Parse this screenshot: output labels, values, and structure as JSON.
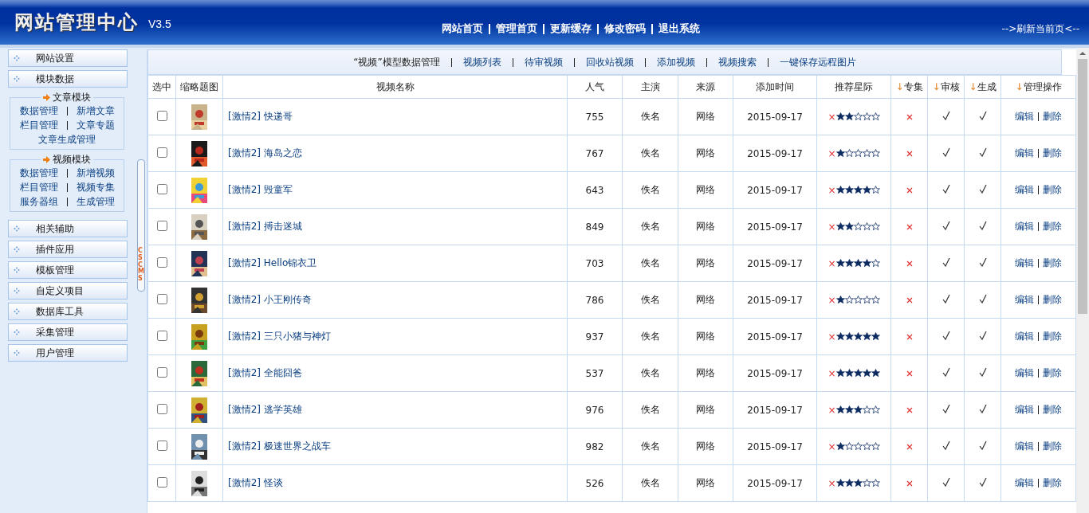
{
  "header": {
    "title": "网站管理中心",
    "version": "V3.5",
    "nav": [
      "网站首页",
      "管理首页",
      "更新缓存",
      "修改密码",
      "退出系统"
    ],
    "refresh": "-->刷新当前页<--"
  },
  "sidebar": {
    "items_top": [
      "网站设置",
      "模块数据"
    ],
    "groups": [
      {
        "title": "文章模块",
        "rows": [
          [
            "数据管理",
            "新增文章"
          ],
          [
            "栏目管理",
            "文章专题"
          ],
          [
            "文章生成管理"
          ]
        ]
      },
      {
        "title": "视频模块",
        "rows": [
          [
            "数据管理",
            "新增视频"
          ],
          [
            "栏目管理",
            "视频专集"
          ],
          [
            "服务器组",
            "生成管理"
          ]
        ]
      }
    ],
    "items_bottom": [
      "相关辅助",
      "插件应用",
      "模板管理",
      "自定义项目",
      "数据库工具",
      "采集管理",
      "用户管理"
    ]
  },
  "splitter": {
    "label": "CSCMS"
  },
  "toolbar": {
    "title": "“视频”模型数据管理",
    "links": [
      "视频列表",
      "待审视频",
      "回收站视频",
      "添加视频",
      "视频搜索",
      "一键保存远程图片"
    ]
  },
  "table": {
    "columns": [
      {
        "label": "选中"
      },
      {
        "label": "缩略题图"
      },
      {
        "label": "视频名称"
      },
      {
        "label": "人气"
      },
      {
        "label": "主演"
      },
      {
        "label": "来源"
      },
      {
        "label": "添加时间"
      },
      {
        "label": "推荐星际"
      },
      {
        "label": "专集",
        "arrow": "↓"
      },
      {
        "label": "审核",
        "arrow": "↓"
      },
      {
        "label": "生成",
        "arrow": "↓"
      },
      {
        "label": "管理操作",
        "arrow": "↓"
      }
    ],
    "rows": [
      {
        "checked": false,
        "category": "[激情2]",
        "title": "快递哥",
        "views": "755",
        "actor": "佚名",
        "source": "网络",
        "date": "2015-09-17",
        "clear": "×",
        "stars": 2,
        "album": false,
        "approved": true,
        "generated": true,
        "edit": "编辑",
        "delete": "删除"
      },
      {
        "checked": false,
        "category": "[激情2]",
        "title": "海岛之恋",
        "views": "767",
        "actor": "佚名",
        "source": "网络",
        "date": "2015-09-17",
        "clear": "×",
        "stars": 1,
        "album": false,
        "approved": true,
        "generated": true,
        "edit": "编辑",
        "delete": "删除"
      },
      {
        "checked": false,
        "category": "[激情2]",
        "title": "毁童军",
        "views": "643",
        "actor": "佚名",
        "source": "网络",
        "date": "2015-09-17",
        "clear": "×",
        "stars": 4,
        "album": false,
        "approved": true,
        "generated": true,
        "edit": "编辑",
        "delete": "删除"
      },
      {
        "checked": false,
        "category": "[激情2]",
        "title": "搏击迷城",
        "views": "849",
        "actor": "佚名",
        "source": "网络",
        "date": "2015-09-17",
        "clear": "×",
        "stars": 2,
        "album": false,
        "approved": true,
        "generated": true,
        "edit": "编辑",
        "delete": "删除"
      },
      {
        "checked": false,
        "category": "[激情2]",
        "title": "Hello锦衣卫",
        "views": "703",
        "actor": "佚名",
        "source": "网络",
        "date": "2015-09-17",
        "clear": "×",
        "stars": 4,
        "album": false,
        "approved": true,
        "generated": true,
        "edit": "编辑",
        "delete": "删除"
      },
      {
        "checked": false,
        "category": "[激情2]",
        "title": "小王刚传奇",
        "views": "786",
        "actor": "佚名",
        "source": "网络",
        "date": "2015-09-17",
        "clear": "×",
        "stars": 1,
        "album": false,
        "approved": true,
        "generated": true,
        "edit": "编辑",
        "delete": "删除"
      },
      {
        "checked": false,
        "category": "[激情2]",
        "title": "三只小猪与神灯",
        "views": "937",
        "actor": "佚名",
        "source": "网络",
        "date": "2015-09-17",
        "clear": "×",
        "stars": 5,
        "album": false,
        "approved": true,
        "generated": true,
        "edit": "编辑",
        "delete": "删除"
      },
      {
        "checked": false,
        "category": "[激情2]",
        "title": "全能囧爸",
        "views": "537",
        "actor": "佚名",
        "source": "网络",
        "date": "2015-09-17",
        "clear": "×",
        "stars": 5,
        "album": false,
        "approved": true,
        "generated": true,
        "edit": "编辑",
        "delete": "删除"
      },
      {
        "checked": false,
        "category": "[激情2]",
        "title": "逃学英雄",
        "views": "976",
        "actor": "佚名",
        "source": "网络",
        "date": "2015-09-17",
        "clear": "×",
        "stars": 3,
        "album": false,
        "approved": true,
        "generated": true,
        "edit": "编辑",
        "delete": "删除"
      },
      {
        "checked": false,
        "category": "[激情2]",
        "title": "极速世界之战车",
        "views": "982",
        "actor": "佚名",
        "source": "网络",
        "date": "2015-09-17",
        "clear": "×",
        "stars": 1,
        "album": false,
        "approved": true,
        "generated": true,
        "edit": "编辑",
        "delete": "删除"
      },
      {
        "checked": false,
        "category": "[激情2]",
        "title": "怪谈",
        "views": "526",
        "actor": "佚名",
        "source": "网络",
        "date": "2015-09-17",
        "clear": "×",
        "stars": 3,
        "album": false,
        "approved": true,
        "generated": true,
        "edit": "编辑",
        "delete": "删除"
      }
    ]
  }
}
